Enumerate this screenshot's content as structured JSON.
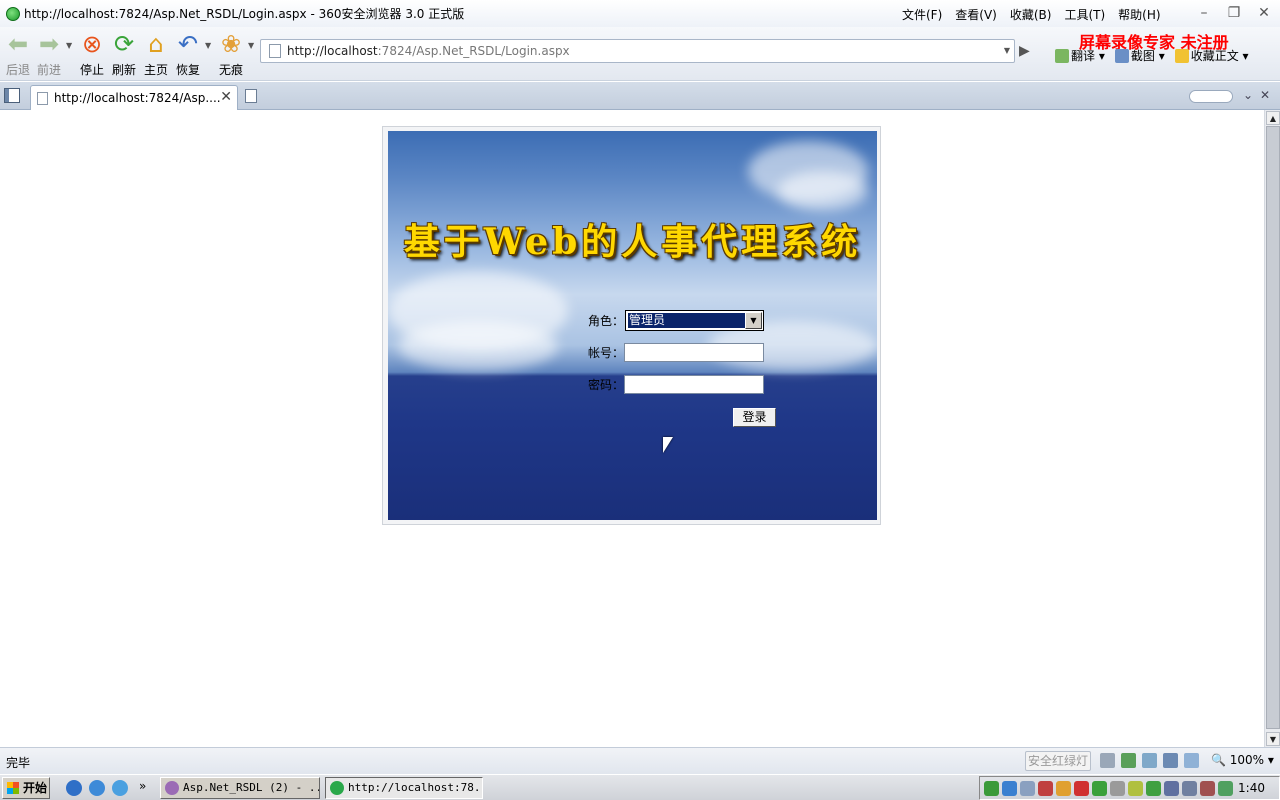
{
  "window": {
    "title": "http://localhost:7824/Asp.Net_RSDL/Login.aspx - 360安全浏览器 3.0 正式版",
    "menus": [
      "文件(F)",
      "查看(V)",
      "收藏(B)",
      "工具(T)",
      "帮助(H)"
    ]
  },
  "toolbar": {
    "back": "后退",
    "forward": "前进",
    "stop": "停止",
    "refresh": "刷新",
    "home": "主页",
    "restore": "恢复",
    "private": "无痕",
    "address_host": "http://localhost",
    "address_path": ":7824/Asp.Net_RSDL/Login.aspx",
    "translate": "翻译",
    "screenshot": "截图",
    "favorite_text": "收藏正文",
    "recorder_watermark": "屏幕录像专家  未注册"
  },
  "tabs": [
    {
      "label": "http://localhost:7824/Asp...."
    }
  ],
  "page": {
    "system_title": "基于Web的人事代理系统",
    "role_label": "角色：",
    "role_value": "管理员",
    "account_label": "帐号：",
    "account_value": "",
    "password_label": "密码：",
    "password_value": "",
    "login_button": "登录"
  },
  "status": {
    "text": "完毕",
    "safety_light": "安全红绿灯",
    "zoom": "100%"
  },
  "taskbar": {
    "start": "开始",
    "items": [
      {
        "label": "Asp.Net_RSDL (2) - ..."
      },
      {
        "label": "http://localhost:78..."
      }
    ],
    "clock": "1:40"
  },
  "colors": {
    "recorder_text": "#ff0000",
    "title_gold": "#ffd800",
    "select_highlight": "#0a246a"
  },
  "icons": [
    "back-icon",
    "forward-icon",
    "stop-icon",
    "refresh-icon",
    "home-icon",
    "undo-icon",
    "paw-icon",
    "page-icon",
    "close-icon"
  ]
}
